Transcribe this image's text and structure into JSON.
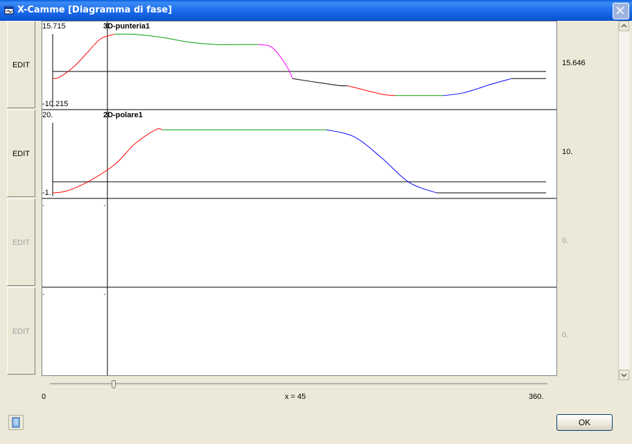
{
  "window": {
    "title": "X-Camme  [Diagramma di fase]"
  },
  "panels": [
    {
      "name": "3D-punteria1",
      "top": "15.715",
      "bottom": "-10.215",
      "value": "15.646",
      "edit": "EDIT",
      "enabled": true
    },
    {
      "name": "2D-polare1",
      "top": "20.",
      "bottom": "-1.",
      "value": "10.",
      "edit": "EDIT",
      "enabled": true
    },
    {
      "name": "",
      "top": ".",
      "bottom": ".",
      "value": "0.",
      "edit": "EDIT",
      "enabled": false
    },
    {
      "name": "",
      "top": ".",
      "bottom": ".",
      "value": "0.",
      "edit": "EDIT",
      "enabled": false
    }
  ],
  "axis": {
    "min": "0",
    "max": "360.",
    "current": "x = 45",
    "x": 45
  },
  "chart_data": [
    {
      "type": "line",
      "title": "3D-punteria1",
      "xlim": [
        0,
        360
      ],
      "ylim": [
        -10.215,
        15.715
      ],
      "series": [
        {
          "color": "#FF0000",
          "x": [
            0,
            5,
            15,
            25,
            35,
            45
          ],
          "y": [
            0,
            0.5,
            4,
            9,
            14,
            15.646
          ]
        },
        {
          "color": "#00A000",
          "x": [
            45,
            60,
            80,
            100,
            120,
            140,
            150
          ],
          "y": [
            15.646,
            15.6,
            14.5,
            12.8,
            12,
            12,
            12
          ]
        },
        {
          "color": "#FF00FF",
          "x": [
            150,
            160,
            170,
            175
          ],
          "y": [
            12,
            11,
            5,
            0
          ]
        },
        {
          "color": "#000000",
          "x": [
            175,
            195,
            210,
            215
          ],
          "y": [
            0,
            -1.5,
            -2.5,
            -2.5
          ]
        },
        {
          "color": "#FF0000",
          "x": [
            215,
            240,
            250
          ],
          "y": [
            -2.5,
            -5.5,
            -6
          ]
        },
        {
          "color": "#00A000",
          "x": [
            250,
            285
          ],
          "y": [
            -6,
            -6
          ]
        },
        {
          "color": "#0000FF",
          "x": [
            285,
            300,
            320,
            335
          ],
          "y": [
            -6,
            -5,
            -2,
            0
          ]
        },
        {
          "color": "#000000",
          "x": [
            335,
            360
          ],
          "y": [
            0,
            0
          ]
        }
      ]
    },
    {
      "type": "line",
      "title": "2D-polare1",
      "xlim": [
        0,
        360
      ],
      "ylim": [
        -1,
        20
      ],
      "series": [
        {
          "color": "#FF0000",
          "x": [
            0,
            10,
            25,
            45,
            60,
            75,
            80
          ],
          "y": [
            0,
            0.5,
            3,
            8,
            14,
            18,
            18
          ]
        },
        {
          "color": "#00A000",
          "x": [
            80,
            200
          ],
          "y": [
            18,
            18
          ]
        },
        {
          "color": "#0000FF",
          "x": [
            200,
            220,
            240,
            260,
            280
          ],
          "y": [
            18,
            16,
            10,
            3,
            0
          ]
        },
        {
          "color": "#000000",
          "x": [
            280,
            360
          ],
          "y": [
            0,
            0
          ]
        }
      ]
    }
  ],
  "buttons": {
    "ok": "OK"
  }
}
